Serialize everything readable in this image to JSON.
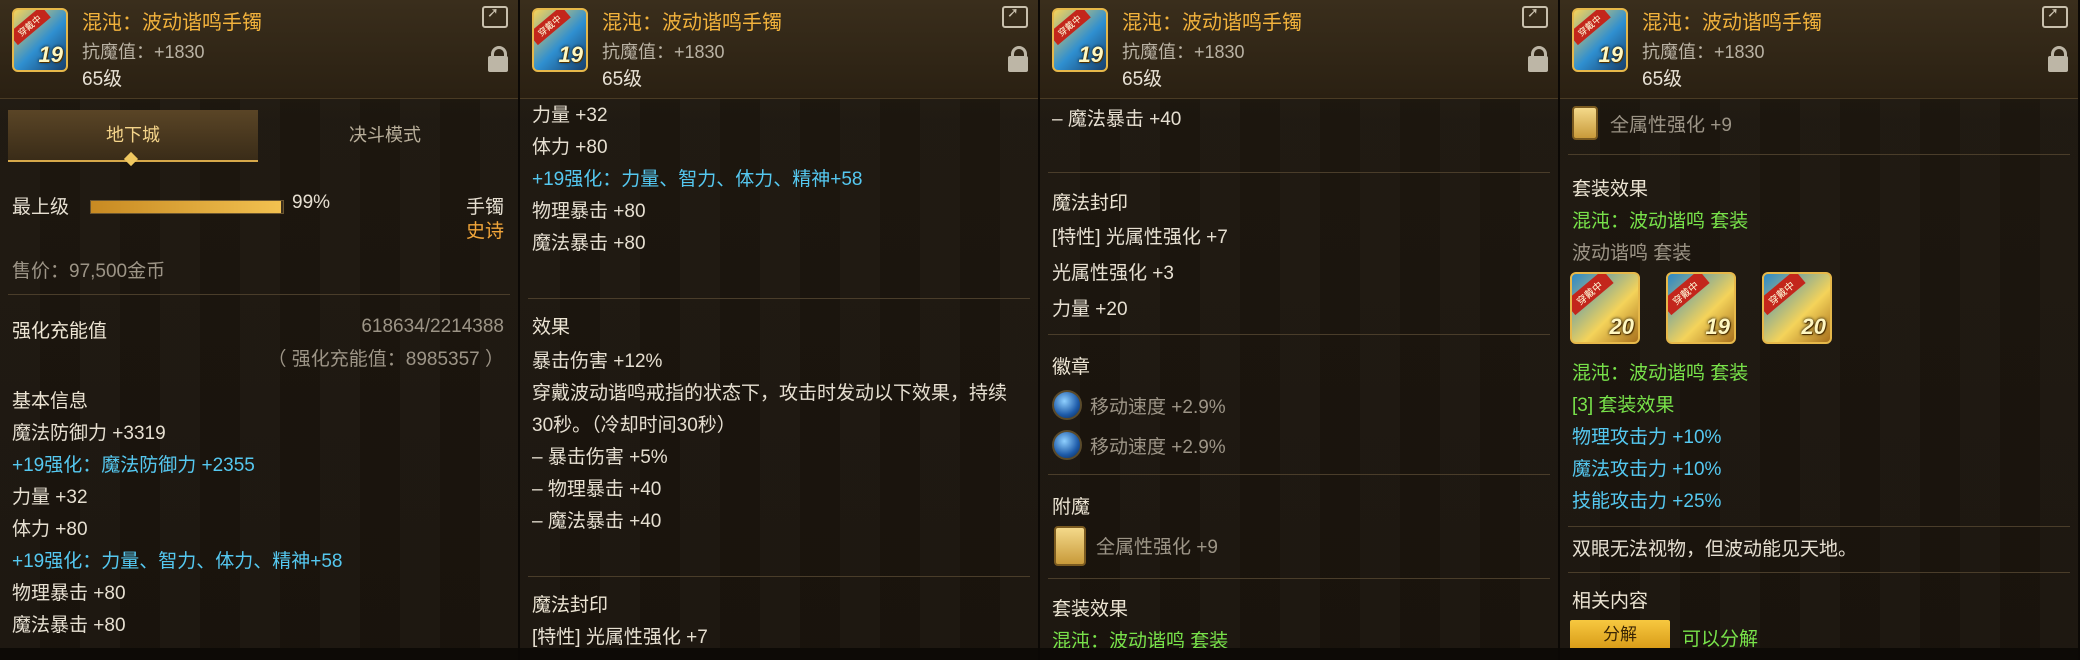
{
  "item": {
    "name": "混沌：波动谐鸣手镯",
    "resist": "抗魔值：+1830",
    "level": "65级",
    "icon_level": "19",
    "icon_ribbon": "穿戴中"
  },
  "panel1": {
    "tabs": [
      "地下城",
      "决斗模式"
    ],
    "grade_label": "最上级",
    "grade_percent": "99%",
    "grade_fraction": 0.99,
    "slot": "手镯",
    "rarity": "史诗",
    "price": "售价：97,500金币",
    "charge_label": "强化充能值",
    "charge_value": "618634/2214388",
    "charge_total": "（ 强化充能值：8985357 ）",
    "basic_title": "基本信息",
    "lines": [
      {
        "text": "魔法防御力 +3319",
        "cls": "white"
      },
      {
        "text": "+19强化：魔法防御力 +2355",
        "cls": "cyan"
      },
      {
        "text": "力量 +32",
        "cls": "white"
      },
      {
        "text": "体力 +80",
        "cls": "white"
      },
      {
        "text": "+19强化：力量、智力、体力、精神+58",
        "cls": "cyan"
      },
      {
        "text": "物理暴击 +80",
        "cls": "white"
      },
      {
        "text": "魔法暴击 +80",
        "cls": "white"
      }
    ]
  },
  "panel2": {
    "top_lines": [
      {
        "text": "力量 +32",
        "cls": "white"
      },
      {
        "text": "体力 +80",
        "cls": "white"
      },
      {
        "text": "+19强化：力量、智力、体力、精神+58",
        "cls": "cyan"
      },
      {
        "text": "物理暴击 +80",
        "cls": "white"
      },
      {
        "text": "魔法暴击 +80",
        "cls": "white"
      }
    ],
    "effect_title": "效果",
    "effect_lines": [
      "暴击伤害 +12%",
      "穿戴波动谐鸣戒指的状态下，攻击时发动以下效果，持续",
      "30秒。（冷却时间30秒）",
      "– 暴击伤害 +5%",
      "– 物理暴击 +40",
      "– 魔法暴击 +40"
    ],
    "seal_title": "魔法封印",
    "seal_cut": "[特性] 光属性强化 +7"
  },
  "panel3": {
    "top_line": "– 魔法暴击 +40",
    "seal_title": "魔法封印",
    "seal_lines": [
      "[特性] 光属性强化 +7",
      "光属性强化 +3",
      "力量 +20"
    ],
    "emblem_title": "徽章",
    "emblems": [
      "移动速度 +2.9%",
      "移动速度 +2.9%"
    ],
    "enchant_title": "附魔",
    "enchant": "全属性强化 +9",
    "set_title": "套装效果",
    "set_cut": "混沌：波动谐鸣 套装"
  },
  "panel4": {
    "enchant": "全属性强化 +9",
    "set_title": "套装效果",
    "set_name": "混沌：波动谐鸣 套装",
    "set_sub": "波动谐鸣 套装",
    "set_icons": [
      "20",
      "19",
      "20"
    ],
    "set_name2": "混沌：波动谐鸣 套装",
    "set_count": "[3] 套装效果",
    "set_bonus": [
      "物理攻击力 +10%",
      "魔法攻击力 +10%",
      "技能攻击力 +25%"
    ],
    "flavor": "双眼无法视物，但波动能见天地。",
    "related_title": "相关内容",
    "decompose_btn": "分解",
    "decompose_note": "可以分解"
  }
}
